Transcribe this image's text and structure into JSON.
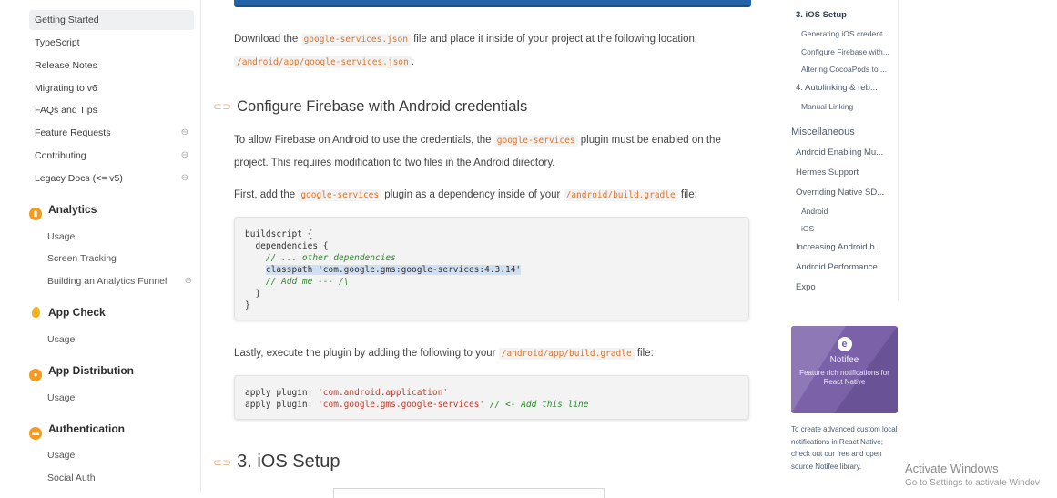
{
  "sidebar": {
    "top_items": [
      {
        "label": "Getting Started",
        "active": true,
        "external": false
      },
      {
        "label": "TypeScript",
        "active": false,
        "external": false
      },
      {
        "label": "Release Notes",
        "active": false,
        "external": false
      },
      {
        "label": "Migrating to v6",
        "active": false,
        "external": false
      },
      {
        "label": "FAQs and Tips",
        "active": false,
        "external": false
      },
      {
        "label": "Feature Requests",
        "active": false,
        "external": true
      },
      {
        "label": "Contributing",
        "active": false,
        "external": true
      },
      {
        "label": "Legacy Docs (<= v5)",
        "active": false,
        "external": true
      }
    ],
    "sections": [
      {
        "title": "Analytics",
        "icon": "analytics-icon",
        "items": [
          "Usage",
          "Screen Tracking",
          "Building an Analytics Funnel"
        ]
      },
      {
        "title": "App Check",
        "icon": "firebase-flame-icon",
        "items": [
          "Usage"
        ]
      },
      {
        "title": "App Distribution",
        "icon": "app-distribution-icon",
        "items": [
          "Usage"
        ]
      },
      {
        "title": "Authentication",
        "icon": "authentication-icon",
        "items": [
          "Usage",
          "Social Auth"
        ]
      }
    ],
    "external_icon": "external-link-icon",
    "accent_color": "#f59a1c"
  },
  "main": {
    "para1_a": "Download the ",
    "para1_code1": "google-services.json",
    "para1_b": " file and place it inside of your project at the following location:",
    "para1_code2": "/android/app/google-services.json",
    "para1_c": ".",
    "heading_configure": "Configure Firebase with Android credentials",
    "para2_a": "To allow Firebase on Android to use the credentials, the ",
    "para2_code": "google-services",
    "para2_b": " plugin must be enabled on the",
    "para2_c": "project. This requires modification to two files in the Android directory.",
    "para3_a": "First, add the ",
    "para3_code1": "google-services",
    "para3_b": " plugin as a dependency inside of your ",
    "para3_code2": "/android/build.gradle",
    "para3_c": " file:",
    "code1": {
      "l1": "buildscript {",
      "l2": "  dependencies {",
      "l3": "    // ... other dependencies",
      "l4_pre": "    ",
      "l4": "classpath 'com.google.gms:google-services:4.3.14'",
      "l5": "    // Add me --- /\\",
      "l6": "  }",
      "l7": "}"
    },
    "para4_a": "Lastly, execute the plugin by adding the following to your ",
    "para4_code": "/android/app/build.gradle",
    "para4_b": " file:",
    "code2": {
      "l1_a": "apply plugin: ",
      "l1_s": "'com.android.application'",
      "l2_a": "apply plugin: ",
      "l2_s": "'com.google.gms.google-services'",
      "l2_c": " // <- Add this line"
    },
    "heading_ios": "3. iOS Setup",
    "link_icon": "link-icon"
  },
  "toc": {
    "items": [
      {
        "label": "3. iOS Setup",
        "style": "bold"
      },
      {
        "label": "Generating iOS credent...",
        "style": "sm"
      },
      {
        "label": "Configure Firebase with...",
        "style": "sm"
      },
      {
        "label": "Altering CocoaPods to ...",
        "style": "sm"
      },
      {
        "label": "4. Autolinking & reb...",
        "style": "normal"
      },
      {
        "label": "Manual Linking",
        "style": "sm"
      }
    ],
    "misc_heading": "Miscellaneous",
    "misc_items": [
      {
        "label": "Android Enabling Mu...",
        "style": "normal"
      },
      {
        "label": "Hermes Support",
        "style": "normal"
      },
      {
        "label": "Overriding Native SD...",
        "style": "normal"
      },
      {
        "label": "Android",
        "style": "sm"
      },
      {
        "label": "iOS",
        "style": "sm"
      },
      {
        "label": "Increasing Android b...",
        "style": "normal"
      },
      {
        "label": "Android Performance",
        "style": "normal"
      },
      {
        "label": "Expo",
        "style": "normal"
      }
    ]
  },
  "ad": {
    "brand": "Notifee",
    "tagline": "Feature rich notifications for React Native",
    "text": "To create advanced custom local notifications in React Native; check out our free and open source Notifee library.",
    "color": "#7b62a8"
  },
  "watermark": {
    "title": "Activate Windows",
    "subtitle": "Go to Settings to activate Windov"
  }
}
